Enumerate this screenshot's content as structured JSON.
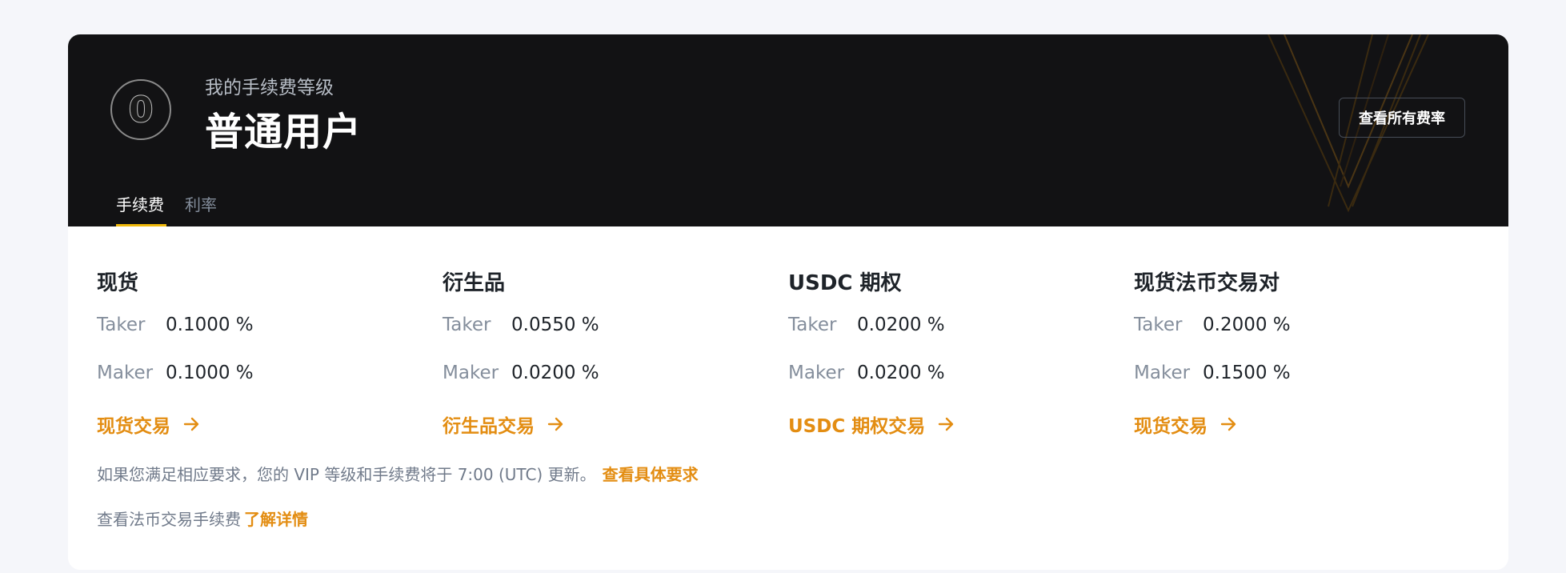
{
  "header": {
    "level_digit": "0",
    "subtitle": "我的手续费等级",
    "title": "普通用户",
    "all_rates_button": "查看所有费率"
  },
  "tabs": [
    {
      "label": "手续费",
      "active": true
    },
    {
      "label": "利率",
      "active": false
    }
  ],
  "fee_columns": [
    {
      "title": "现货",
      "taker_label": "Taker",
      "taker": "0.1000 %",
      "maker_label": "Maker",
      "maker": "0.1000 %",
      "link": "现货交易"
    },
    {
      "title": "衍生品",
      "taker_label": "Taker",
      "taker": "0.0550 %",
      "maker_label": "Maker",
      "maker": "0.0200 %",
      "link": "衍生品交易"
    },
    {
      "title": "USDC 期权",
      "taker_label": "Taker",
      "taker": "0.0200 %",
      "maker_label": "Maker",
      "maker": "0.0200 %",
      "link": "USDC 期权交易"
    },
    {
      "title": "现货法币交易对",
      "taker_label": "Taker",
      "taker": "0.2000 %",
      "maker_label": "Maker",
      "maker": "0.1500 %",
      "link": "现货交易"
    }
  ],
  "notes": {
    "update_text": "如果您满足相应要求，您的 VIP 等级和手续费将于 7:00 (UTC) 更新。",
    "update_link": "查看具体要求",
    "fiat_text": "查看法币交易手续费",
    "fiat_link": "了解详情"
  },
  "colors": {
    "accent": "#e38d12",
    "tab_underline": "#f0b90b",
    "header_bg": "#121214",
    "page_bg": "#f5f6fa"
  }
}
